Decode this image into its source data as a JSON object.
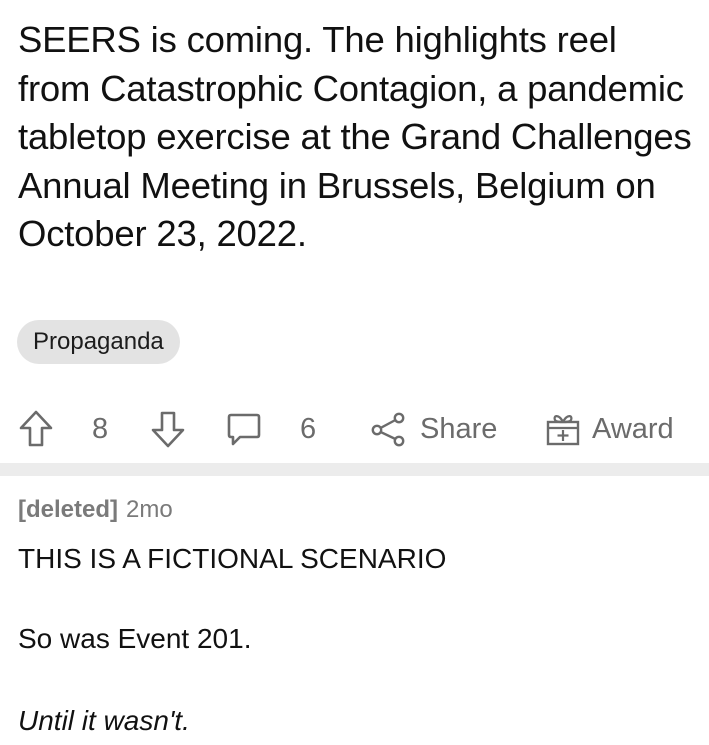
{
  "post": {
    "title": "SEERS is coming. The highlights reel from Catastrophic Contagion, a pandemic tabletop exercise at the Grand Challenges Annual Meeting in Brussels, Belgium on October 23, 2022.",
    "flair": "Propaganda"
  },
  "actions": {
    "upvote_icon": "arrow-up-icon",
    "vote_count": "8",
    "downvote_icon": "arrow-down-icon",
    "comment_icon": "comment-bubble-icon",
    "comment_count": "6",
    "share_icon": "share-icon",
    "share_label": "Share",
    "award_icon": "gift-icon",
    "award_label": "Award"
  },
  "comment": {
    "author": "[deleted]",
    "age": "2mo",
    "line1": "THIS IS A FICTIONAL SCENARIO",
    "line2": "So was Event 201.",
    "line3": "Until it wasn't."
  },
  "colors": {
    "text": "#111111",
    "muted": "#6b6b6b",
    "flair_bg": "#e3e3e3",
    "divider": "#ececec"
  }
}
